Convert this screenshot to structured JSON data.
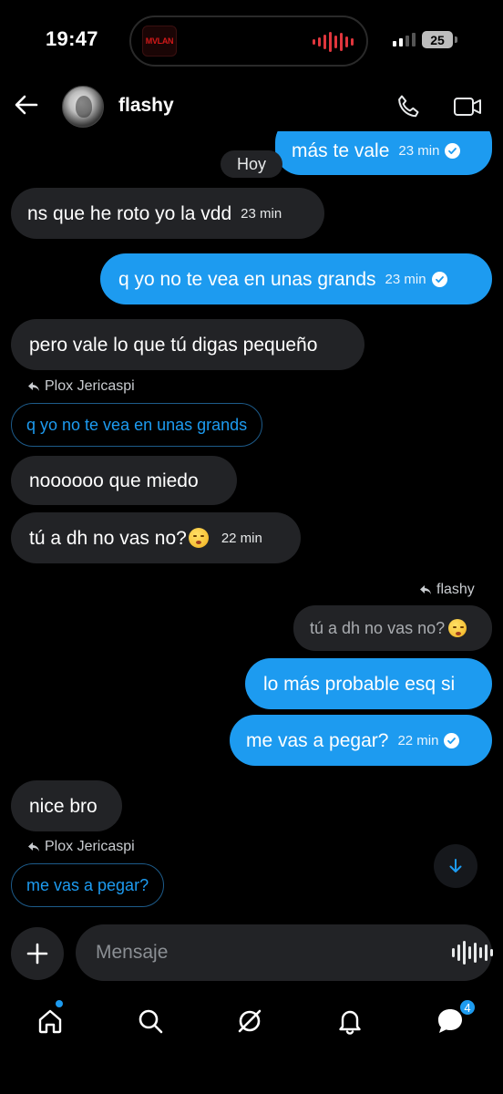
{
  "status": {
    "time": "19:47",
    "island_art_text": "MVLAN",
    "battery": "25"
  },
  "header": {
    "contact_name": "flashy"
  },
  "chat": {
    "day": "Hoy",
    "messages": [
      {
        "id": "m1",
        "dir": "out",
        "text": "más te vale",
        "time": "23 min",
        "read": true
      },
      {
        "id": "m2",
        "dir": "in",
        "text": "ns que he roto yo la vdd",
        "time": "23 min"
      },
      {
        "id": "m3",
        "dir": "out",
        "text": "q yo no te vea en unas grands",
        "time": "23 min",
        "read": true
      },
      {
        "id": "m4",
        "dir": "in",
        "text": "pero vale lo que tú digas pequeño"
      },
      {
        "id": "m5",
        "dir": "in",
        "reply_to_name": "Plox Jericaspi",
        "reply_to_text": "q yo no te vea en unas grands"
      },
      {
        "id": "m6",
        "dir": "in",
        "text": "noooooo que miedo"
      },
      {
        "id": "m7",
        "dir": "in",
        "text": "tú a dh no vas no?",
        "time": "22 min",
        "emoji": "face-exhaling-emoji"
      },
      {
        "id": "m8",
        "dir": "out",
        "reply_to_name": "flashy",
        "reply_to_text": "tú a dh no vas no?"
      },
      {
        "id": "m9",
        "dir": "out",
        "text": "lo más probable esq si"
      },
      {
        "id": "m10",
        "dir": "out",
        "text": "me vas a pegar?",
        "time": "22 min",
        "read": true
      },
      {
        "id": "m11",
        "dir": "in",
        "text": "nice bro"
      },
      {
        "id": "m12",
        "dir": "in",
        "reply_to_name": "Plox Jericaspi",
        "reply_to_text": "me vas a pegar?"
      }
    ]
  },
  "composer": {
    "placeholder": "Mensaje"
  },
  "tabbar": {
    "messages_badge": "4"
  },
  "colors": {
    "accent": "#1d9bf0",
    "incoming_bubble": "#222326",
    "background": "#000000"
  }
}
